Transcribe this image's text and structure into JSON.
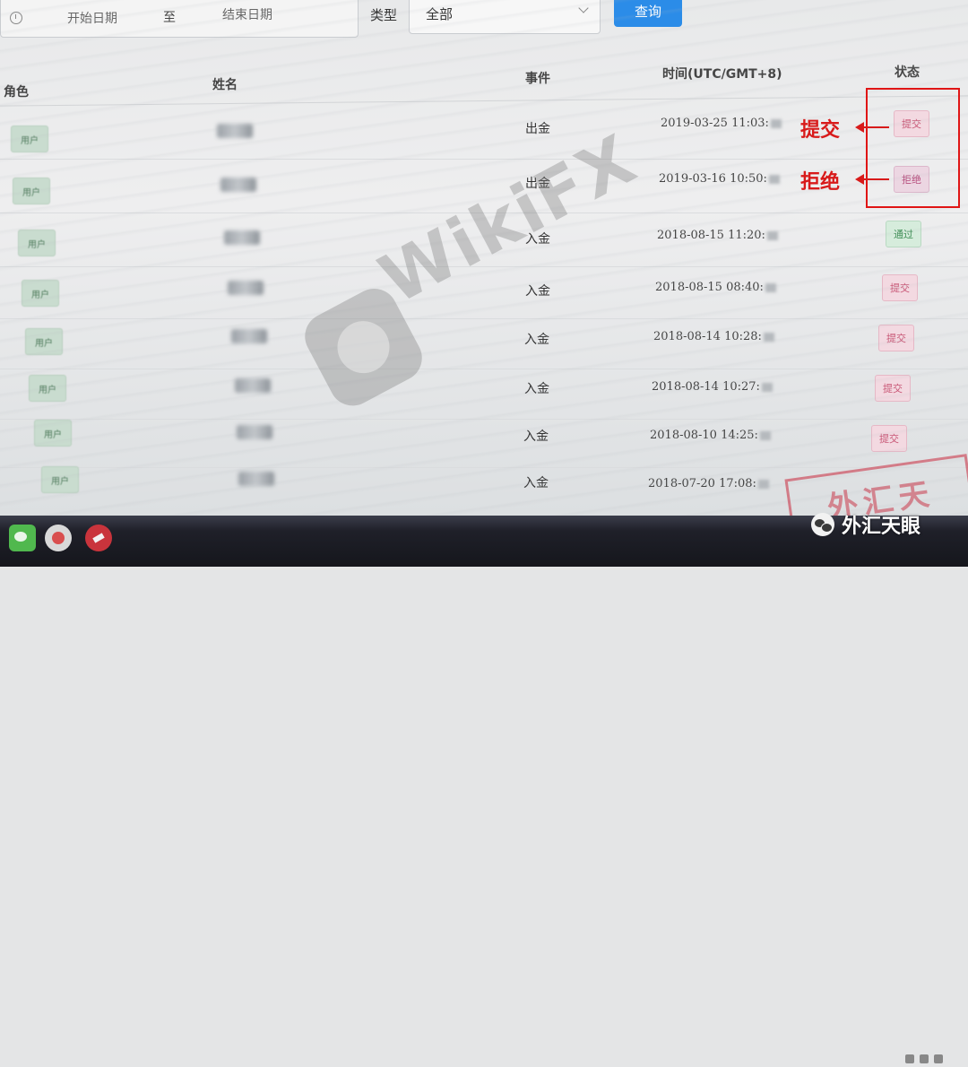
{
  "filters": {
    "date_start_placeholder": "开始日期",
    "date_separator": "至",
    "date_end_placeholder": "结束日期",
    "type_label": "类型",
    "type_value": "全部",
    "query_button": "查询"
  },
  "table": {
    "headers": {
      "role": "角色",
      "name": "姓名",
      "event": "事件",
      "time": "时间(UTC/GMT+8)",
      "status": "状态"
    },
    "rows": [
      {
        "role": "用户",
        "event": "出金",
        "time": "2019-03-25 11:03:",
        "status": "提交",
        "status_kind": "submit"
      },
      {
        "role": "用户",
        "event": "出金",
        "time": "2019-03-16 10:50:",
        "status": "拒绝",
        "status_kind": "reject"
      },
      {
        "role": "用户",
        "event": "入金",
        "time": "2018-08-15 11:20:",
        "status": "通过",
        "status_kind": "pass"
      },
      {
        "role": "用户",
        "event": "入金",
        "time": "2018-08-15 08:40:",
        "status": "提交",
        "status_kind": "submit"
      },
      {
        "role": "用户",
        "event": "入金",
        "time": "2018-08-14 10:28:",
        "status": "提交",
        "status_kind": "submit"
      },
      {
        "role": "用户",
        "event": "入金",
        "time": "2018-08-14 10:27:",
        "status": "提交",
        "status_kind": "submit"
      },
      {
        "role": "用户",
        "event": "入金",
        "time": "2018-08-10 14:25:",
        "status": "提交",
        "status_kind": "submit"
      },
      {
        "role": "用户",
        "event": "入金",
        "time": "2018-07-20 17:08:",
        "status": "",
        "status_kind": "submit"
      }
    ]
  },
  "annotations": {
    "submit_label": "提交",
    "reject_label": "拒绝",
    "color": "#d81a1a"
  },
  "watermark": {
    "text": "WikiFX"
  },
  "stamp": {
    "text": "外汇天眼"
  },
  "brand": {
    "text": "外汇天眼"
  },
  "colors": {
    "primary": "#2b8ce8",
    "submit_tag": "#c85675",
    "reject_tag": "#b74f7e",
    "pass_tag": "#3e8e55",
    "role_tag": "#4d7a5a"
  }
}
